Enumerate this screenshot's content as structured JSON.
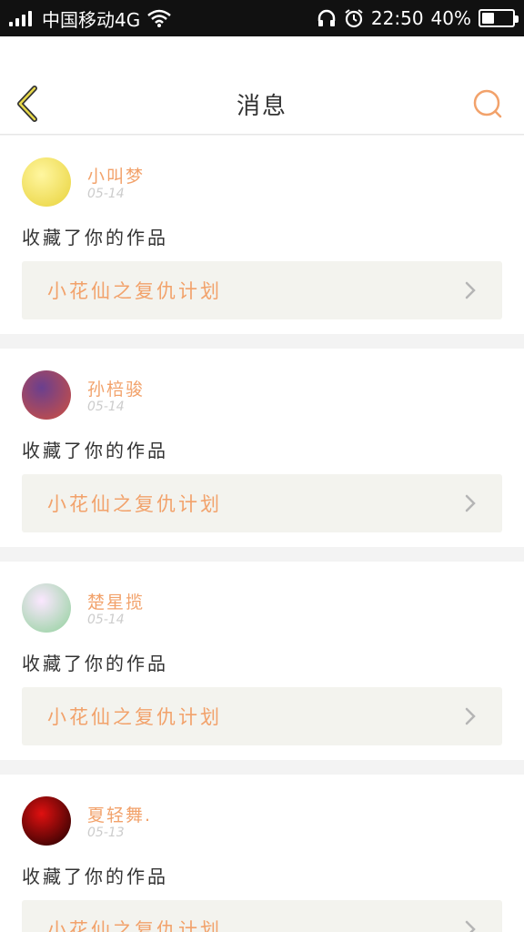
{
  "status_bar": {
    "carrier": "中国移动4G",
    "time": "22:50",
    "battery_percent": "40%",
    "battery_level": 0.4
  },
  "header": {
    "title": "消息",
    "accent_color": "#f2a26b"
  },
  "messages": [
    {
      "username": "小叫梦",
      "time": "05-14",
      "action": "收藏了你的作品",
      "work_title": "小花仙之复仇计划",
      "avatar_colors": [
        "#fff6a0",
        "#e8d23a"
      ]
    },
    {
      "username": "孙棓骏",
      "time": "05-14",
      "action": "收藏了你的作品",
      "work_title": "小花仙之复仇计划",
      "avatar_colors": [
        "#6a3f8f",
        "#d0503f"
      ]
    },
    {
      "username": "楚星揽",
      "time": "05-14",
      "action": "收藏了你的作品",
      "work_title": "小花仙之复仇计划",
      "avatar_colors": [
        "#fbe7ff",
        "#8fd19a"
      ]
    },
    {
      "username": "夏轻舞.",
      "time": "05-13",
      "action": "收藏了你的作品",
      "work_title": "小花仙之复仇计划",
      "avatar_colors": [
        "#e01010",
        "#1a0000"
      ]
    }
  ]
}
